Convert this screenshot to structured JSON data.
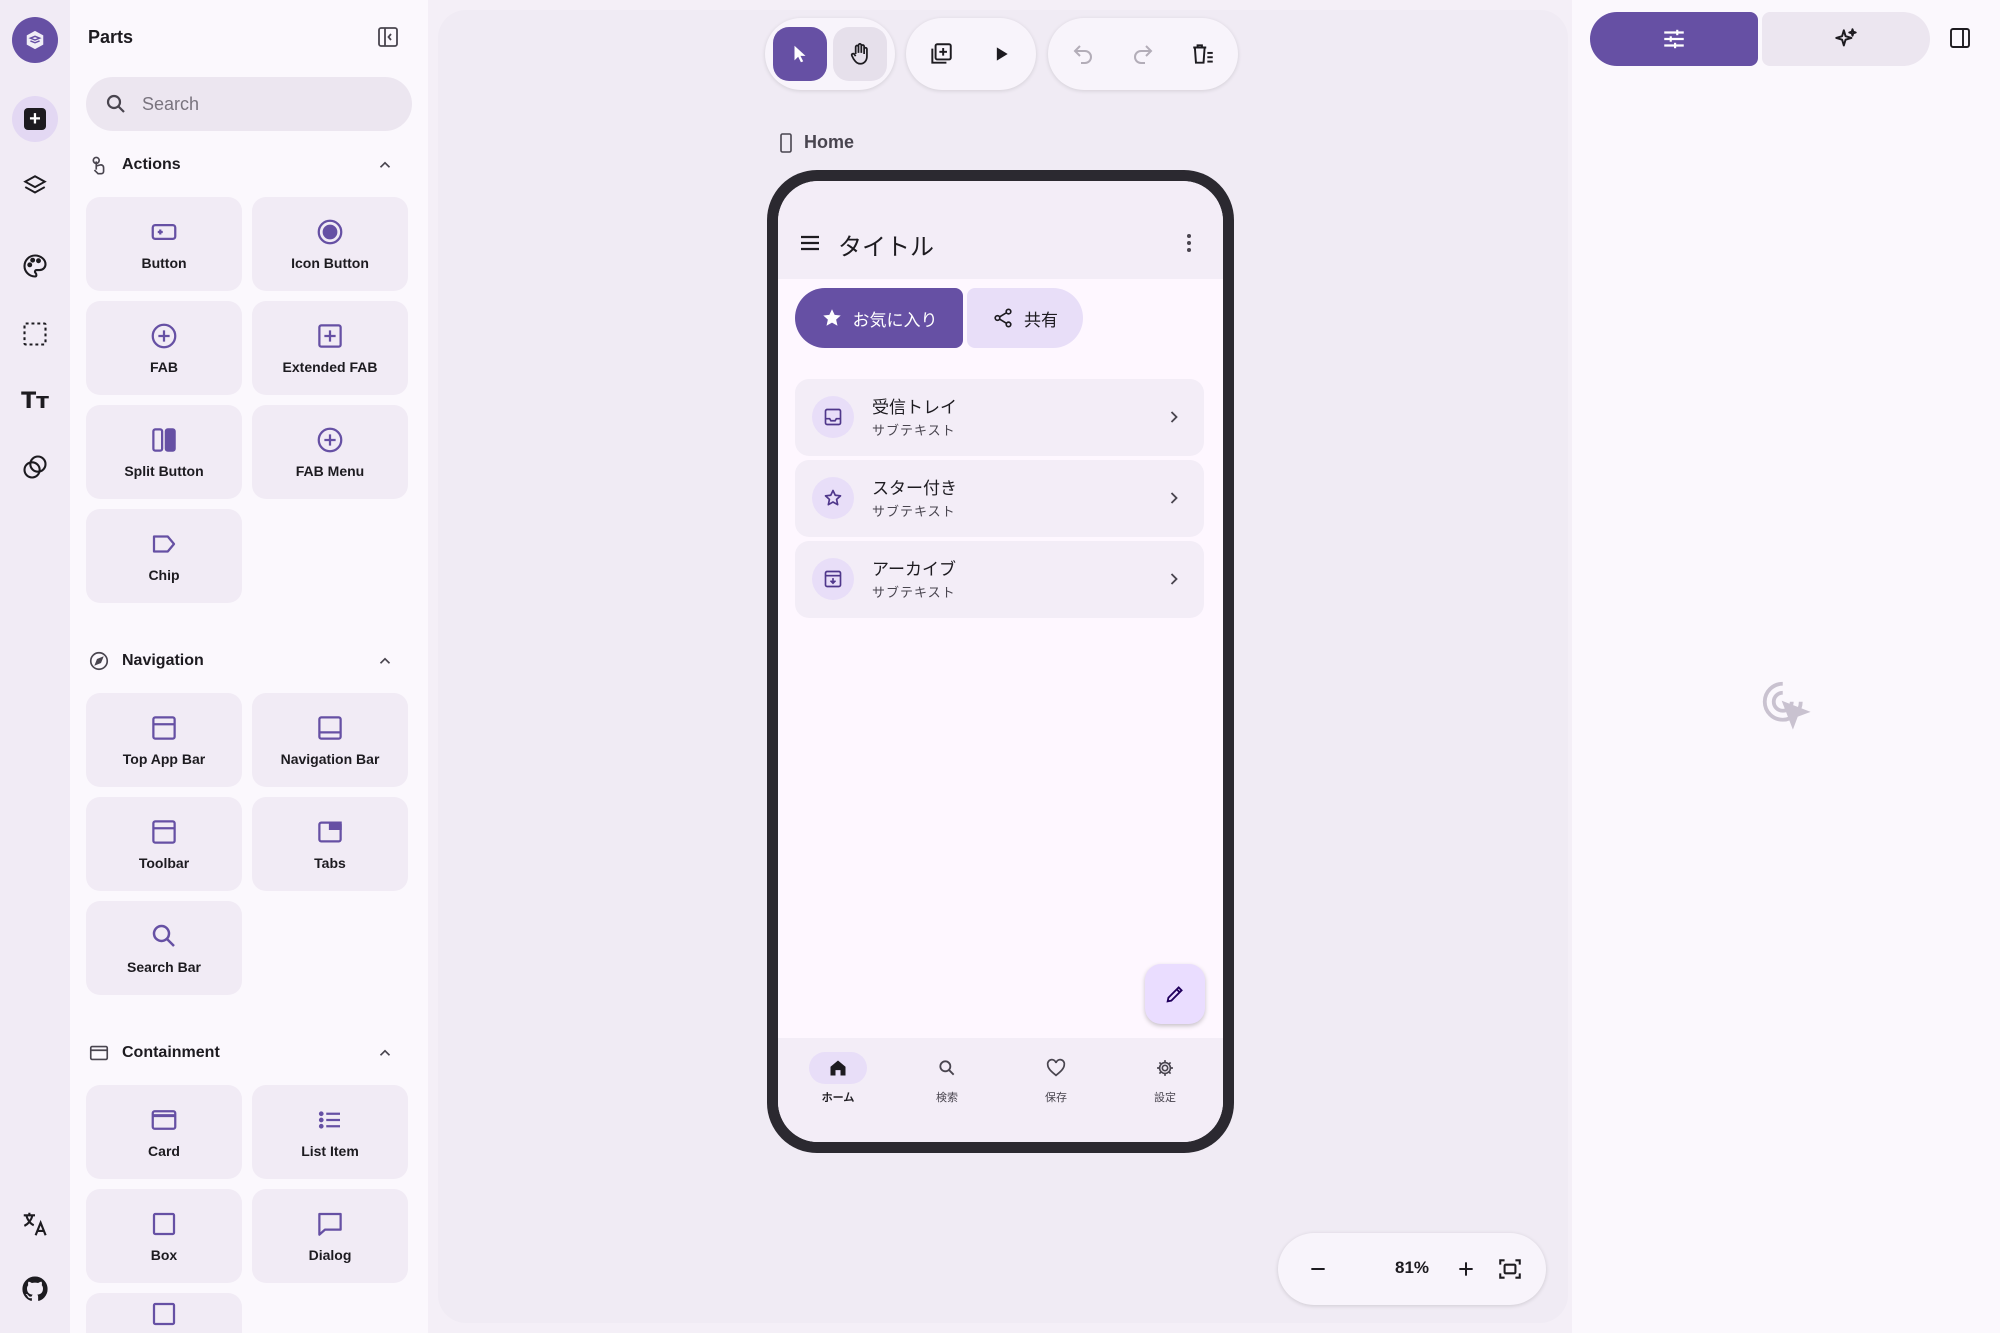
{
  "colors": {
    "primary": "#6650a4",
    "primary_container": "#eaddff",
    "secondary_container": "#e8def8",
    "surface": "#fef7ff",
    "surface_container": "#f3edf7",
    "on_surface": "#1d1b20"
  },
  "rail": {
    "items": [
      {
        "icon": "logo-icon"
      },
      {
        "icon": "add-component-icon",
        "active": true
      },
      {
        "icon": "layers-icon"
      },
      {
        "icon": "palette-icon"
      },
      {
        "icon": "select-area-icon"
      },
      {
        "icon": "typography-icon",
        "glyph": "Tт"
      },
      {
        "icon": "shapes-icon"
      },
      {
        "icon": "translate-icon"
      },
      {
        "icon": "github-icon"
      }
    ]
  },
  "parts": {
    "title": "Parts",
    "search_placeholder": "Search",
    "sections": {
      "actions": {
        "label": "Actions",
        "items": [
          "Button",
          "Icon Button",
          "FAB",
          "Extended FAB",
          "Split Button",
          "FAB Menu",
          "Chip"
        ]
      },
      "navigation": {
        "label": "Navigation",
        "items": [
          "Top App Bar",
          "Navigation Bar",
          "Toolbar",
          "Tabs",
          "Search Bar"
        ]
      },
      "containment": {
        "label": "Containment",
        "items": [
          "Card",
          "List Item",
          "Box",
          "Dialog"
        ]
      }
    }
  },
  "canvas": {
    "frame_label": "Home",
    "zoom": "81%",
    "toolbar": {
      "tools": [
        "select-tool",
        "hand-tool",
        "add-frame",
        "play",
        "undo",
        "redo",
        "delete-list"
      ]
    }
  },
  "phone": {
    "app_bar_title": "タイトル",
    "buttons": {
      "favorite": "お気に入り",
      "share": "共有"
    },
    "list": [
      {
        "title": "受信トレイ",
        "subtitle": "サブテキスト",
        "icon": "inbox-icon"
      },
      {
        "title": "スター付き",
        "subtitle": "サブテキスト",
        "icon": "star-outline-icon"
      },
      {
        "title": "アーカイブ",
        "subtitle": "サブテキスト",
        "icon": "archive-icon"
      }
    ],
    "nav": [
      "ホーム",
      "検索",
      "保存",
      "設定"
    ]
  },
  "right_panel": {
    "tabs": [
      "properties-tab",
      "ai-tab"
    ]
  }
}
